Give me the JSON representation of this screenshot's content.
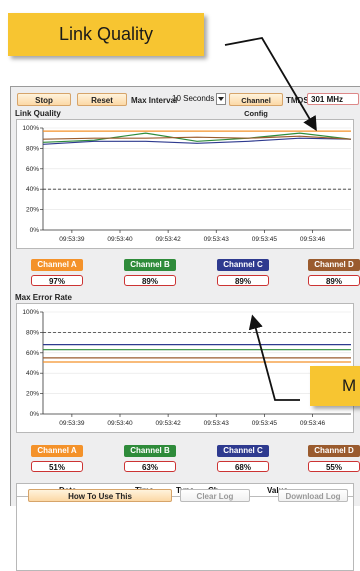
{
  "callouts": {
    "top": "Link Quality",
    "bottom": "M"
  },
  "toolbar": {
    "stop_label": "Stop",
    "reset_label": "Reset",
    "max_interval_label": "Max Interval",
    "max_interval_value": "10 Seconds",
    "channel_config_label": "Channel Config",
    "tmds_label": "TMDS",
    "tmds_value": "301 MHz"
  },
  "link_quality": {
    "title": "Link Quality"
  },
  "max_error": {
    "title": "Max Error Rate"
  },
  "channels": [
    {
      "name": "Channel A",
      "color": "#f4922a"
    },
    {
      "name": "Channel B",
      "color": "#2e8b3a"
    },
    {
      "name": "Channel C",
      "color": "#2e3a8f"
    },
    {
      "name": "Channel D",
      "color": "#9a5b2e"
    }
  ],
  "link_quality_values": [
    "97%",
    "89%",
    "89%",
    "89%"
  ],
  "max_error_values": [
    "51%",
    "63%",
    "68%",
    "55%"
  ],
  "log": {
    "columns": [
      "Date",
      "Time",
      "Type",
      "Ch",
      "Value"
    ]
  },
  "footer": {
    "how_to_label": "How To Use This",
    "clear_label": "Clear Log",
    "download_label": "Download Log"
  },
  "chart_data": [
    {
      "type": "line",
      "title": "Link Quality",
      "x": [
        "09:53:39",
        "09:53:40",
        "09:53:42",
        "09:53:43",
        "09:53:45",
        "09:53:46"
      ],
      "yticks": [
        "0%",
        "20%",
        "40%",
        "60%",
        "80%",
        "100%"
      ],
      "ylim": [
        0,
        100
      ],
      "threshold": 40,
      "series": [
        {
          "name": "Channel A",
          "color": "#f4922a",
          "values": [
            97,
            97,
            97,
            97,
            97,
            97,
            97
          ]
        },
        {
          "name": "Channel B",
          "color": "#2e8b3a",
          "values": [
            86,
            88,
            95,
            87,
            90,
            95,
            89
          ]
        },
        {
          "name": "Channel C",
          "color": "#2e3a8f",
          "values": [
            84,
            87,
            87,
            85,
            87,
            90,
            89
          ]
        },
        {
          "name": "Channel D",
          "color": "#9a5b2e",
          "values": [
            89,
            90,
            90,
            91,
            90,
            92,
            89
          ]
        }
      ]
    },
    {
      "type": "line",
      "title": "Max Error Rate",
      "x": [
        "09:53:39",
        "09:53:40",
        "09:53:42",
        "09:53:43",
        "09:53:45",
        "09:53:46"
      ],
      "yticks": [
        "0%",
        "20%",
        "40%",
        "60%",
        "80%",
        "100%"
      ],
      "ylim": [
        0,
        100
      ],
      "threshold": 80,
      "series": [
        {
          "name": "Channel A",
          "color": "#f4922a",
          "values": [
            51,
            51,
            51,
            51,
            51,
            51,
            51
          ]
        },
        {
          "name": "Channel B",
          "color": "#2e8b3a",
          "values": [
            63,
            63,
            63,
            63,
            63,
            63,
            63
          ]
        },
        {
          "name": "Channel C",
          "color": "#2e3a8f",
          "values": [
            68,
            68,
            68,
            68,
            68,
            68,
            68
          ]
        },
        {
          "name": "Channel D",
          "color": "#9a5b2e",
          "values": [
            55,
            55,
            55,
            55,
            55,
            55,
            55
          ]
        }
      ]
    }
  ]
}
